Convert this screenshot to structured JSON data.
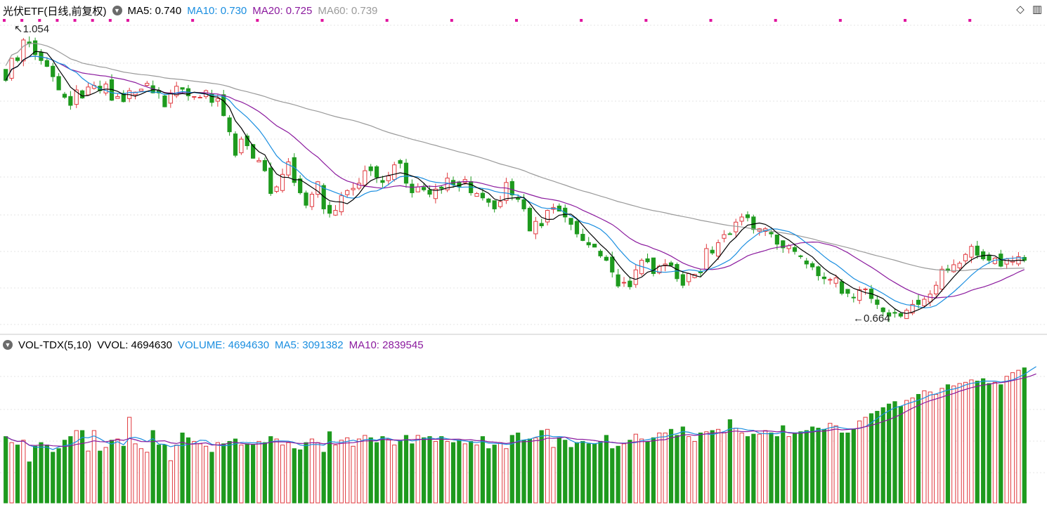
{
  "header": {
    "title": "光伏ETF(日线,前复权)",
    "ma5": "MA5: 0.740",
    "ma10": "MA10: 0.730",
    "ma20": "MA20: 0.725",
    "ma60": "MA60: 0.739"
  },
  "volume_header": {
    "title": "VOL-TDX(5,10)",
    "vvol": "VVOL: 4694630",
    "volume": "VOLUME: 4694630",
    "ma5": "MA5: 3091382",
    "ma10": "MA10: 2839545"
  },
  "colors": {
    "up": "#e0393e",
    "down": "#1e9a1e",
    "ma5": "#000000",
    "ma10": "#1a8ee0",
    "ma20": "#8b1a9e",
    "ma60": "#9a9a9a",
    "signal": "#e0139e"
  },
  "chart_data": {
    "type": "candlestick",
    "annotations": {
      "high_label": "1.054",
      "low_label": "0.664"
    },
    "price_range": [
      0.645,
      1.06
    ],
    "closes": [
      0.985,
      1.015,
      1.012,
      1.04,
      1.035,
      1.02,
      1.012,
      1.004,
      0.99,
      0.972,
      0.962,
      0.951,
      0.972,
      0.961,
      0.976,
      0.978,
      0.971,
      0.98,
      0.958,
      0.963,
      0.956,
      0.971,
      0.969,
      0.973,
      0.981,
      0.968,
      0.968,
      0.949,
      0.968,
      0.977,
      0.973,
      0.964,
      0.963,
      0.962,
      0.971,
      0.955,
      0.96,
      0.937,
      0.915,
      0.883,
      0.905,
      0.896,
      0.879,
      0.876,
      0.862,
      0.831,
      0.84,
      0.857,
      0.874,
      0.846,
      0.832,
      0.815,
      0.83,
      0.847,
      0.81,
      0.804,
      0.808,
      0.828,
      0.835,
      0.838,
      0.845,
      0.862,
      0.862,
      0.853,
      0.846,
      0.855,
      0.87,
      0.872,
      0.845,
      0.832,
      0.84,
      0.836,
      0.83,
      0.837,
      0.838,
      0.852,
      0.843,
      0.84,
      0.85,
      0.832,
      0.831,
      0.825,
      0.819,
      0.81,
      0.82,
      0.846,
      0.829,
      0.823,
      0.81,
      0.78,
      0.793,
      0.787,
      0.808,
      0.812,
      0.807,
      0.799,
      0.789,
      0.776,
      0.767,
      0.761,
      0.758,
      0.746,
      0.74,
      0.724,
      0.705,
      0.71,
      0.704,
      0.727,
      0.74,
      0.738,
      0.722,
      0.732,
      0.735,
      0.733,
      0.715,
      0.706,
      0.722,
      0.721,
      0.723,
      0.756,
      0.75,
      0.764,
      0.775,
      0.776,
      0.792,
      0.799,
      0.798,
      0.782,
      0.783,
      0.783,
      0.776,
      0.762,
      0.757,
      0.76,
      0.752,
      0.745,
      0.735,
      0.731,
      0.719,
      0.715,
      0.714,
      0.716,
      0.695,
      0.695,
      0.689,
      0.7,
      0.701,
      0.688,
      0.68,
      0.67,
      0.664,
      0.668,
      0.664,
      0.672,
      0.68,
      0.68,
      0.687,
      0.694,
      0.706,
      0.728,
      0.726,
      0.734,
      0.736,
      0.748,
      0.759,
      0.747,
      0.742,
      0.74,
      0.743,
      0.732,
      0.742,
      0.739,
      0.745,
      0.74
    ],
    "volumes_relative": [
      0.55,
      0.5,
      0.48,
      0.52,
      0.34,
      0.47,
      0.5,
      0.48,
      0.42,
      0.45,
      0.52,
      0.55,
      0.6,
      0.6,
      0.43,
      0.6,
      0.43,
      0.46,
      0.52,
      0.53,
      0.47,
      0.71,
      0.49,
      0.45,
      0.42,
      0.6,
      0.48,
      0.48,
      0.35,
      0.48,
      0.58,
      0.54,
      0.51,
      0.49,
      0.47,
      0.42,
      0.5,
      0.49,
      0.51,
      0.53,
      0.48,
      0.49,
      0.48,
      0.51,
      0.5,
      0.55,
      0.53,
      0.48,
      0.5,
      0.45,
      0.44,
      0.5,
      0.53,
      0.5,
      0.42,
      0.59,
      0.48,
      0.52,
      0.54,
      0.47,
      0.53,
      0.56,
      0.54,
      0.5,
      0.55,
      0.53,
      0.48,
      0.51,
      0.56,
      0.49,
      0.56,
      0.54,
      0.55,
      0.51,
      0.55,
      0.51,
      0.5,
      0.52,
      0.49,
      0.51,
      0.48,
      0.55,
      0.45,
      0.48,
      0.5,
      0.45,
      0.56,
      0.58,
      0.52,
      0.53,
      0.54,
      0.6,
      0.61,
      0.46,
      0.54,
      0.52,
      0.46,
      0.5,
      0.51,
      0.49,
      0.49,
      0.51,
      0.56,
      0.45,
      0.47,
      0.49,
      0.52,
      0.57,
      0.53,
      0.51,
      0.54,
      0.58,
      0.58,
      0.61,
      0.56,
      0.63,
      0.55,
      0.51,
      0.58,
      0.59,
      0.6,
      0.61,
      0.58,
      0.69,
      0.62,
      0.58,
      0.55,
      0.57,
      0.57,
      0.6,
      0.58,
      0.55,
      0.64,
      0.55,
      0.58,
      0.59,
      0.6,
      0.63,
      0.62,
      0.61,
      0.66,
      0.64,
      0.58,
      0.58,
      0.61,
      0.68,
      0.71,
      0.74,
      0.76,
      0.79,
      0.82,
      0.84,
      0.8,
      0.85,
      0.87,
      0.9,
      0.93,
      0.92,
      0.9,
      0.95,
      0.98,
      0.97,
      0.99,
      1.0,
      1.02,
      1.01,
      1.03,
      0.99,
      1.0,
      0.98,
      1.05,
      1.08,
      1.1,
      1.12,
      1.15,
      1.2
    ]
  }
}
